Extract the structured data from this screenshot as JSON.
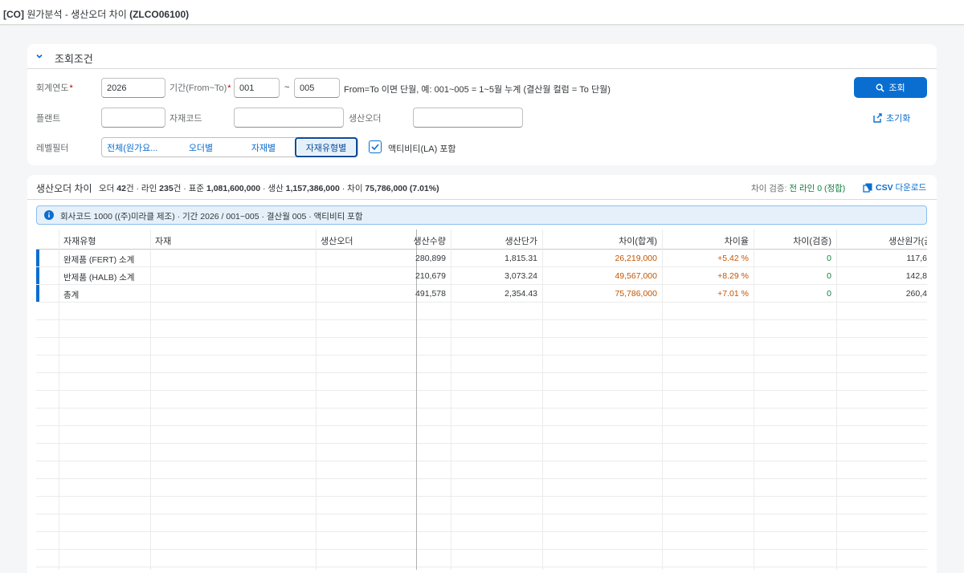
{
  "header": {
    "module": "[CO]",
    "name": "원가분석 - 생산오더 차이",
    "tcode": "(ZLCO06100)"
  },
  "filter": {
    "title": "조회조건",
    "fiscal_year_label": "회계연도",
    "fiscal_year_value": "2026",
    "period_label": "기간(From~To)",
    "period_from": "001",
    "tilde": "~",
    "period_to": "005",
    "period_hint": "From=To 이면 단월, 예: 001~005 = 1~5월 누계 (결산월 컬럼 = To 단월)",
    "plant_label": "플랜트",
    "plant_value": "",
    "material_label": "자재코드",
    "material_value": "",
    "order_label": "생산오더",
    "order_value": "",
    "level_label": "레벨필터",
    "segments": [
      "전체(원가요...",
      "오더별",
      "자재별",
      "자재유형별"
    ],
    "selected_segment": "자재유형별",
    "activity_checked": true,
    "activity_label": "액티비티(LA) 포함",
    "search_button": "조회",
    "reset_button": "초기화",
    "required_mark": "*"
  },
  "table": {
    "title": "생산오더 차이",
    "summary": {
      "orders_label": "오더",
      "orders": "42",
      "orders_unit": "건 · 라인",
      "lines": "235",
      "lines_unit": "건 · 표준",
      "standard": "1,081,600,000",
      "actual_label": "· 생산",
      "actual": "1,157,386,000",
      "variance_label": "· 차이",
      "variance": "75,786,000 (7.01%)"
    },
    "verify_label": "차이 검증:",
    "verify_value": "전 라인 0 (정합)",
    "csv_bold": "CSV",
    "csv_rest": "다운로드",
    "info": "회사코드 1000 ((주)미라클 제조) · 기간 2026 / 001~005 · 결산월 005 · 액티비티 포함",
    "columns": {
      "material_type": "자재유형",
      "material": "자재",
      "order": "생산오더",
      "qty": "생산수량",
      "unit_price": "생산단가",
      "variance_total": "차이(합계)",
      "variance_rate": "차이율",
      "variance_check": "차이(검증)",
      "cost": "생산원가(금"
    },
    "rows": [
      {
        "type": "완제품 (FERT) 소계",
        "qty": "280,899",
        "unit": "1,815.31",
        "var": "26,219,000",
        "rate": "+5.42 %",
        "check": "0",
        "cost": "117,6"
      },
      {
        "type": "반제품 (HALB) 소계",
        "qty": "210,679",
        "unit": "3,073.24",
        "var": "49,567,000",
        "rate": "+8.29 %",
        "check": "0",
        "cost": "142,8"
      },
      {
        "type": "총계",
        "qty": "491,578",
        "unit": "2,354.43",
        "var": "75,786,000",
        "rate": "+7.01 %",
        "check": "0",
        "cost": "260,4"
      }
    ]
  },
  "colors": {
    "accent": "#0a6ed1",
    "variance": "#c35500",
    "ok": "#107e3e",
    "required": "#bb0000"
  }
}
